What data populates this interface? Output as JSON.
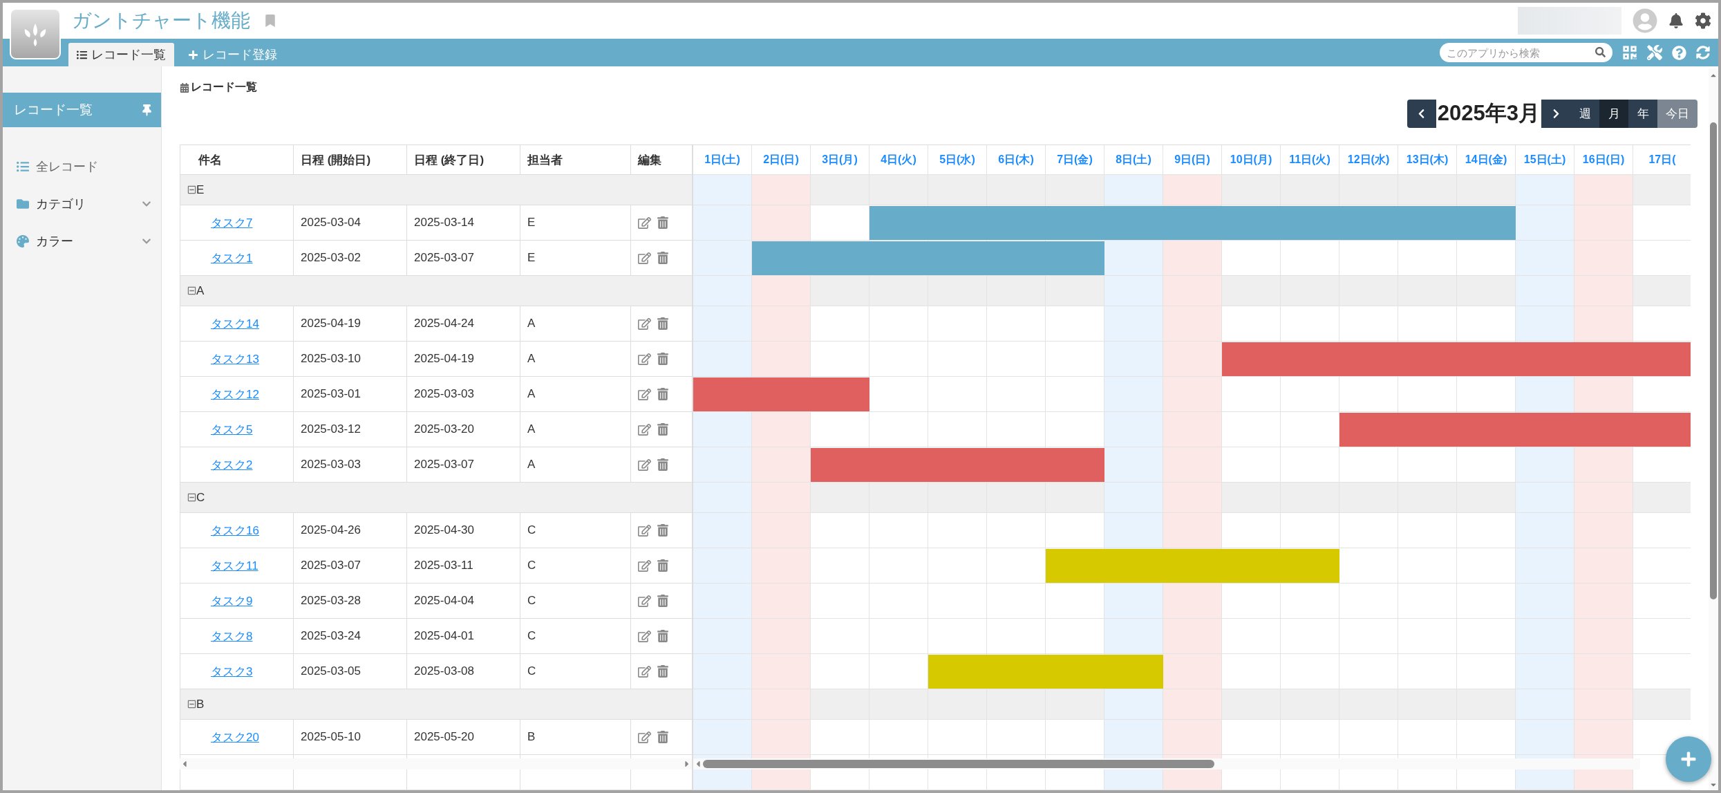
{
  "app": {
    "title": "ガントチャート機能"
  },
  "tabs": [
    {
      "label": "レコード一覧",
      "selected": true
    },
    {
      "label": "レコード登録",
      "selected": false
    }
  ],
  "search": {
    "placeholder": "このアプリから検索"
  },
  "sidebar": {
    "header": "レコード一覧",
    "items": [
      {
        "kind": "list",
        "label": "全レコード",
        "expandable": false
      },
      {
        "kind": "folder",
        "label": "カテゴリ",
        "expandable": true
      },
      {
        "kind": "palette",
        "label": "カラー",
        "expandable": true
      }
    ]
  },
  "view": {
    "title": "レコード一覧",
    "month": "2025年3月",
    "modes": [
      {
        "label": "週",
        "selected": false
      },
      {
        "label": "月",
        "selected": true
      },
      {
        "label": "年",
        "selected": false
      }
    ],
    "today": "今日"
  },
  "table": {
    "columns": [
      "件名",
      "日程 (開始日)",
      "日程 (終了日)",
      "担当者",
      "編集"
    ],
    "groups": [
      {
        "label": "E",
        "expanded": true,
        "color": "#67acc9",
        "rows": [
          {
            "name": "タスク7",
            "start": "2025-03-04",
            "end": "2025-03-14",
            "assignee": "E"
          },
          {
            "name": "タスク1",
            "start": "2025-03-02",
            "end": "2025-03-07",
            "assignee": "E"
          }
        ]
      },
      {
        "label": "A",
        "expanded": true,
        "color": "#e06060",
        "rows": [
          {
            "name": "タスク14",
            "start": "2025-04-19",
            "end": "2025-04-24",
            "assignee": "A"
          },
          {
            "name": "タスク13",
            "start": "2025-03-10",
            "end": "2025-04-19",
            "assignee": "A"
          },
          {
            "name": "タスク12",
            "start": "2025-03-01",
            "end": "2025-03-03",
            "assignee": "A"
          },
          {
            "name": "タスク5",
            "start": "2025-03-12",
            "end": "2025-03-20",
            "assignee": "A"
          },
          {
            "name": "タスク2",
            "start": "2025-03-03",
            "end": "2025-03-07",
            "assignee": "A"
          }
        ]
      },
      {
        "label": "C",
        "expanded": true,
        "color": "#d6c900",
        "rows": [
          {
            "name": "タスク16",
            "start": "2025-04-26",
            "end": "2025-04-30",
            "assignee": "C"
          },
          {
            "name": "タスク11",
            "start": "2025-03-07",
            "end": "2025-03-11",
            "assignee": "C"
          },
          {
            "name": "タスク9",
            "start": "2025-03-28",
            "end": "2025-04-04",
            "assignee": "C"
          },
          {
            "name": "タスク8",
            "start": "2025-03-24",
            "end": "2025-04-01",
            "assignee": "C"
          },
          {
            "name": "タスク3",
            "start": "2025-03-05",
            "end": "2025-03-08",
            "assignee": "C"
          }
        ]
      },
      {
        "label": "B",
        "expanded": true,
        "rows": [
          {
            "name": "タスク20",
            "start": "2025-05-10",
            "end": "2025-05-20",
            "assignee": "B"
          }
        ]
      }
    ]
  },
  "gantt": {
    "days": [
      {
        "label": "1日(土)",
        "kind": "saturday"
      },
      {
        "label": "2日(日)",
        "kind": "sunday"
      },
      {
        "label": "3日(月)",
        "kind": "weekday"
      },
      {
        "label": "4日(火)",
        "kind": "weekday"
      },
      {
        "label": "5日(水)",
        "kind": "weekday"
      },
      {
        "label": "6日(木)",
        "kind": "weekday"
      },
      {
        "label": "7日(金)",
        "kind": "weekday"
      },
      {
        "label": "8日(土)",
        "kind": "saturday"
      },
      {
        "label": "9日(日)",
        "kind": "sunday"
      },
      {
        "label": "10日(月)",
        "kind": "weekday"
      },
      {
        "label": "11日(火)",
        "kind": "weekday"
      },
      {
        "label": "12日(水)",
        "kind": "weekday"
      },
      {
        "label": "13日(木)",
        "kind": "weekday"
      },
      {
        "label": "14日(金)",
        "kind": "weekday"
      },
      {
        "label": "15日(土)",
        "kind": "saturday"
      },
      {
        "label": "16日(日)",
        "kind": "sunday"
      },
      {
        "label": "17日(",
        "kind": "weekday"
      }
    ]
  }
}
